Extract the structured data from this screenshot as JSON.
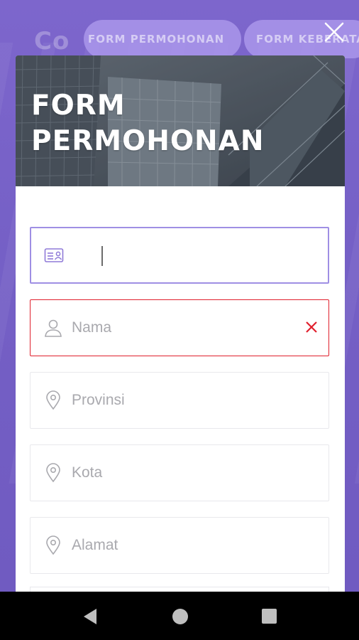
{
  "background": {
    "logo_text": "Co",
    "tabs": [
      {
        "label": "FORM PERMOHONAN"
      },
      {
        "label": "FORM KEBERATAN"
      }
    ]
  },
  "modal": {
    "title_line1": "FORM",
    "title_line2": "PERMOHONAN",
    "close_icon": "close-icon",
    "fields": [
      {
        "icon": "id-card-icon",
        "placeholder": "",
        "value": "",
        "state": "focused"
      },
      {
        "icon": "user-icon",
        "placeholder": "Nama",
        "value": "",
        "state": "error"
      },
      {
        "icon": "location-pin-icon",
        "placeholder": "Provinsi",
        "value": "",
        "state": "normal"
      },
      {
        "icon": "location-pin-icon",
        "placeholder": "Kota",
        "value": "",
        "state": "normal"
      },
      {
        "icon": "location-pin-icon",
        "placeholder": "Alamat",
        "value": "",
        "state": "normal"
      }
    ]
  },
  "colors": {
    "background_purple": "#7a63c9",
    "focus_border": "#9f8fe4",
    "error_red": "#e0202d",
    "icon_purple": "#8f7ad8",
    "icon_gray": "#a9a9ae"
  },
  "navbar": {
    "back": "back-icon",
    "home": "home-icon",
    "recents": "recents-icon"
  }
}
